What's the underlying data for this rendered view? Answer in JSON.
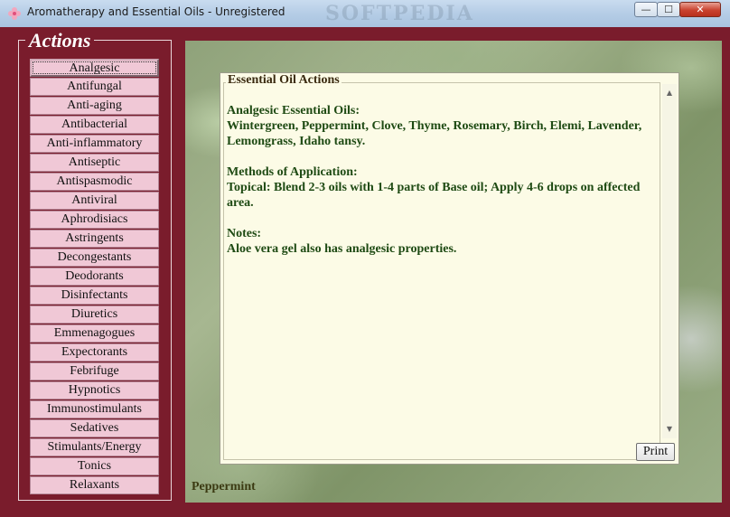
{
  "window": {
    "title": "Aromatherapy and Essential Oils - Unregistered",
    "watermark": "SOFTPEDIA",
    "min_glyph": "—",
    "max_glyph": "☐",
    "close_glyph": "✕"
  },
  "actions": {
    "title": "Actions",
    "items": [
      "Analgesic",
      "Antifungal",
      "Anti-aging",
      "Antibacterial",
      "Anti-inflammatory",
      "Antiseptic",
      "Antispasmodic",
      "Antiviral",
      "Aphrodisiacs",
      "Astringents",
      "Decongestants",
      "Deodorants",
      "Disinfectants",
      "Diuretics",
      "Emmenagogues",
      "Expectorants",
      "Febrifuge",
      "Hypnotics",
      "Immunostimulants",
      "Sedatives",
      "Stimulants/Energy",
      "Tonics",
      "Relaxants"
    ],
    "selected_index": 0
  },
  "panel": {
    "group_title": "Essential Oil Actions",
    "heading1": "Analgesic Essential Oils:",
    "oils": "Wintergreen, Peppermint, Clove, Thyme, Rosemary, Birch, Elemi, Lavender, Lemongrass, Idaho tansy.",
    "heading2": "Methods of Application:",
    "methods": "Topical: Blend 2-3 oils with 1-4 parts of Base oil; Apply 4-6 drops on affected area.",
    "heading3": "Notes:",
    "notes": "Aloe vera gel also has analgesic properties.",
    "scroll_up": "▲",
    "scroll_down": "▼",
    "print_label": "Print"
  },
  "image_caption": "Peppermint",
  "colors": {
    "frame": "#7a1c2c",
    "button": "#f0c8d6",
    "panel_bg": "#fcfbe6",
    "text": "#1e4a13"
  },
  "icons": {
    "app": "flower-icon"
  }
}
